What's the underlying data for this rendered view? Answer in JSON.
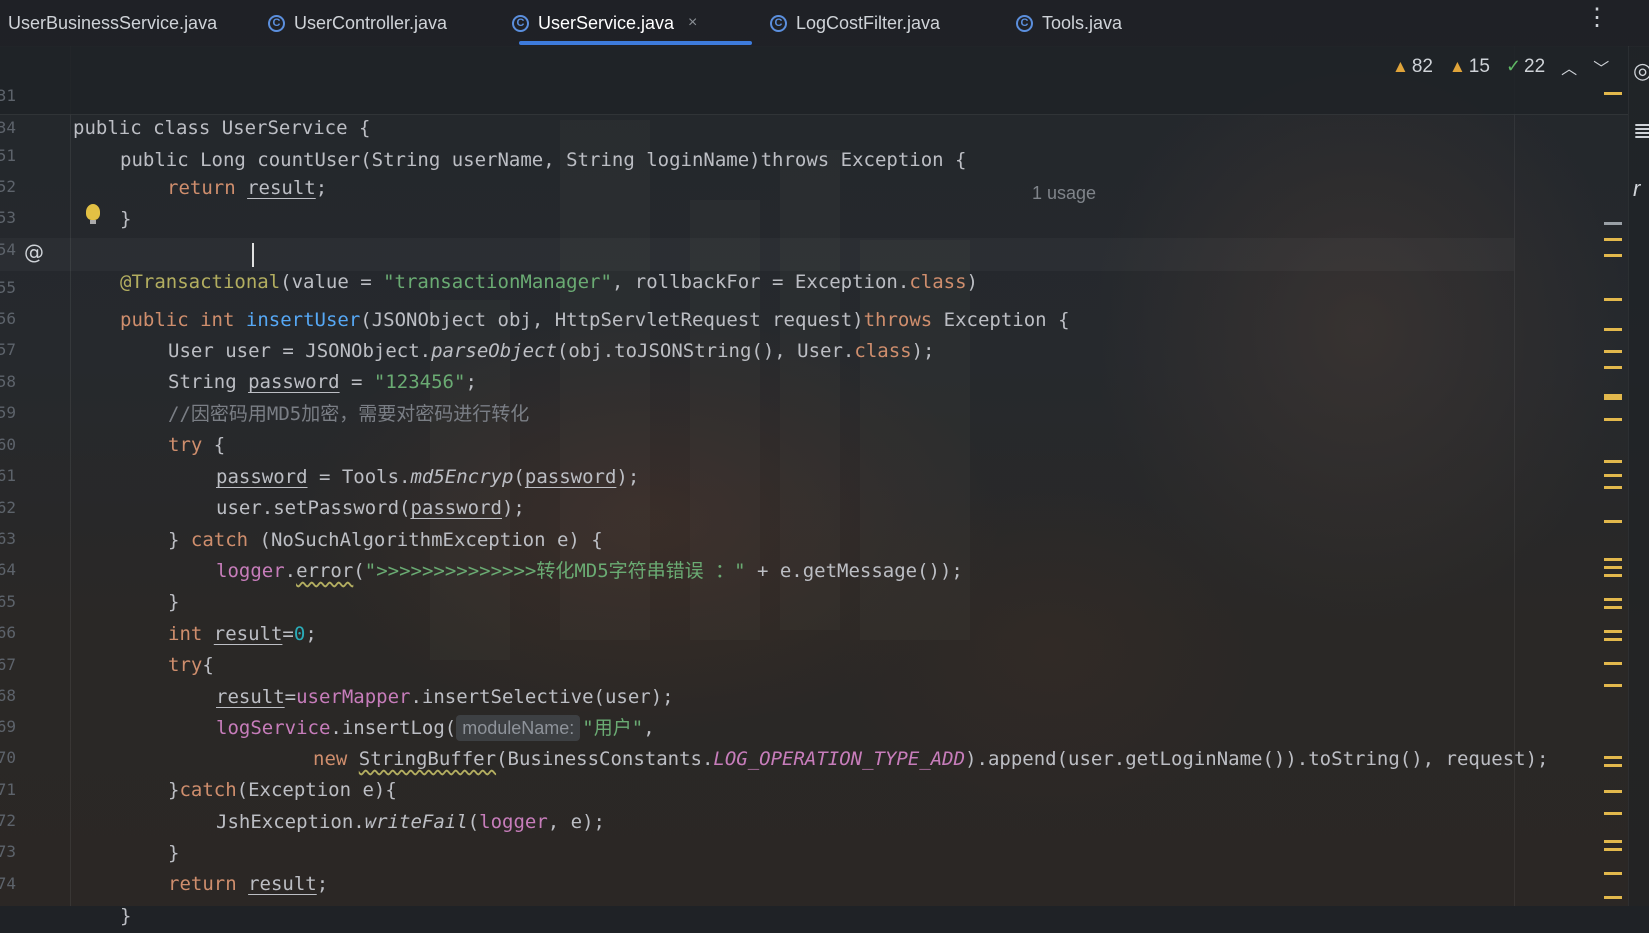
{
  "tabs": [
    {
      "label": "UserBusinessService.java",
      "active": false,
      "icon": "none"
    },
    {
      "label": "UserController.java",
      "active": false,
      "icon": "class-icon"
    },
    {
      "label": "UserService.java",
      "active": true,
      "icon": "class-icon"
    },
    {
      "label": "LogCostFilter.java",
      "active": false,
      "icon": "class-icon"
    },
    {
      "label": "Tools.java",
      "active": false,
      "icon": "class-icon"
    }
  ],
  "tab_close_glyph": "×",
  "menu_glyph": "⋮",
  "inspection": {
    "errors": "82",
    "warnings": "15",
    "ok": "22"
  },
  "sticky_lines": {
    "line1": {
      "number": "31",
      "text": "public class UserService {"
    },
    "line2": {
      "number": "34",
      "text": "public Long countUser(String userName, String loginName)throws Exception {"
    },
    "usage": "1 usage"
  },
  "code_lines": [
    {
      "number": "51"
    },
    {
      "number": "52"
    },
    {
      "number": "53"
    },
    {
      "number": "54"
    },
    {
      "number": "55"
    },
    {
      "number": "56"
    },
    {
      "number": "57"
    },
    {
      "number": "58"
    },
    {
      "number": "59"
    },
    {
      "number": "60"
    },
    {
      "number": "61"
    },
    {
      "number": "62"
    },
    {
      "number": "63"
    },
    {
      "number": "64"
    },
    {
      "number": "65"
    },
    {
      "number": "66"
    },
    {
      "number": "67"
    },
    {
      "number": "68"
    },
    {
      "number": "69"
    },
    {
      "number": "70"
    },
    {
      "number": "71"
    },
    {
      "number": "72"
    },
    {
      "number": "73"
    },
    {
      "number": "74"
    }
  ],
  "tokens": {
    "l51_return": "return",
    "l51_result": "result",
    "l51_semi": ";",
    "l52": "}",
    "l54_ann": "@Transactional",
    "l54_a": "(value = ",
    "l54_str": "\"transactionManager\"",
    "l54_b": ", rollbackFor = Exception.",
    "l54_class": "class",
    "l54_c": ")",
    "l55_public": "public",
    "l55_int": "int",
    "l55_fn": "insertUser",
    "l55_a": "(JSONObject obj, HttpServletRequest request)",
    "l55_throws": "throws",
    "l55_b": " Exception {",
    "l56_a": "User user = JSONObject.",
    "l56_parse": "parseObject",
    "l56_b": "(obj.toJSONString(), User.",
    "l56_class": "class",
    "l56_c": ");",
    "l57_a": "String ",
    "l57_pwd": "password",
    "l57_b": " = ",
    "l57_str": "\"123456\"",
    "l57_c": ";",
    "l58_cmt": "//因密码用MD5加密，需要对密码进行转化",
    "l59_try": "try",
    "l59_b": " {",
    "l60_pwd": "password",
    "l60_a": " = Tools.",
    "l60_md5": "md5Encryp",
    "l60_b": "(",
    "l60_pwd2": "password",
    "l60_c": ");",
    "l61_a": "user.setPassword(",
    "l61_pwd": "password",
    "l61_b": ");",
    "l62_a": "} ",
    "l62_catch": "catch",
    "l62_b": " (NoSuchAlgorithmException e) {",
    "l63_logger": "logger",
    "l63_a": ".",
    "l63_error": "error",
    "l63_b": "(",
    "l63_str": "\">>>>>>>>>>>>>>转化MD5字符串错误 ：\"",
    "l63_c": " + e.getMessage());",
    "l64": "}",
    "l65_int": "int",
    "l65_sp": " ",
    "l65_result": "result",
    "l65_eq": "=",
    "l65_num": "0",
    "l65_semi": ";",
    "l66_try": "try",
    "l66_b": "{",
    "l67_result": "result",
    "l67_eq": "=",
    "l67_mapper": "userMapper",
    "l67_a": ".insertSelective(user);",
    "l68_svc": "logService",
    "l68_a": ".insertLog(",
    "l68_hint": "moduleName:",
    "l68_str": "\"用户\"",
    "l68_b": ",",
    "l69_new": "new",
    "l69_sp": " ",
    "l69_sb": "StringBuffer",
    "l69_a": "(BusinessConstants.",
    "l69_const": "LOG_OPERATION_TYPE_ADD",
    "l69_b": ").append(user.getLoginName()).toString(), request);",
    "l70_a": "}",
    "l70_catch": "catch",
    "l70_b": "(Exception e){",
    "l71_a": "JshException.",
    "l71_wf": "writeFail",
    "l71_b": "(",
    "l71_logger": "logger",
    "l71_c": ", e);",
    "l72": "}",
    "l73_return": "return",
    "l73_sp": " ",
    "l73_result": "result",
    "l73_semi": ";",
    "l74": "}"
  },
  "colors": {
    "keyword": "#cf8e6d",
    "function": "#56a8f5",
    "string": "#6aab73",
    "number": "#2aacb8",
    "annotation": "#b3ae60",
    "field": "#c77dbb",
    "comment": "#7a7e85",
    "accent": "#3d7bdc"
  }
}
